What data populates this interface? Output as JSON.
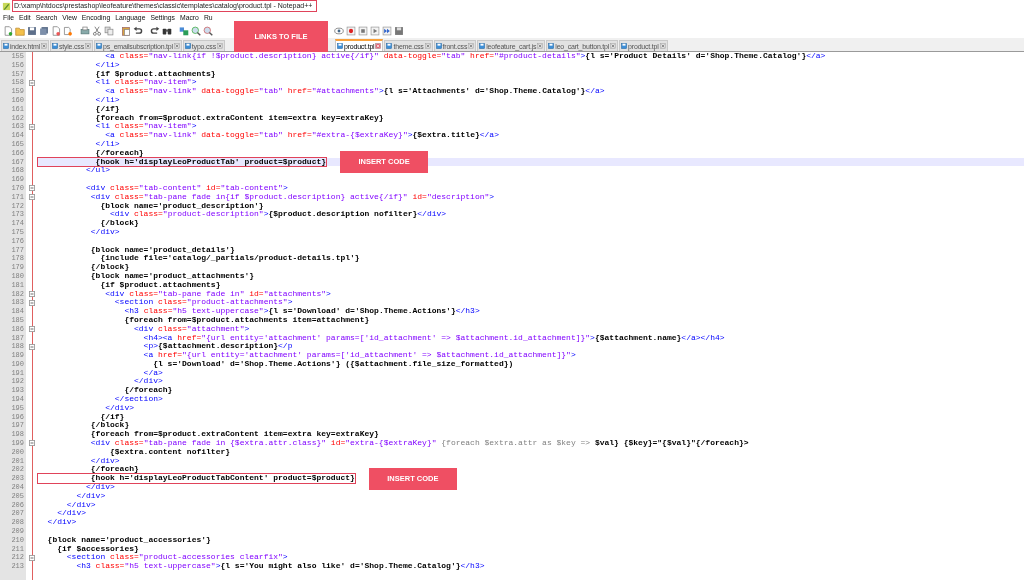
{
  "window": {
    "title": "D:\\xamp\\htdocs\\prestashop\\leofeature\\themes\\classic\\templates\\catalog\\product.tpl - Notepad++",
    "title_highlighted": true
  },
  "menu": [
    "File",
    "Edit",
    "Search",
    "View",
    "Encoding",
    "Language",
    "Settings",
    "Macro",
    "Ru"
  ],
  "links_callout": "LINKS TO FILE",
  "tabs": [
    {
      "label": "index.html",
      "selected": false
    },
    {
      "label": "style.css",
      "selected": false
    },
    {
      "label": "ps_emailsubscription.tpl",
      "selected": false
    },
    {
      "label": "typo.css",
      "selected": false
    },
    {
      "label": "product.tpl",
      "selected": true
    },
    {
      "label": "theme.css",
      "selected": false
    },
    {
      "label": "front.css",
      "selected": false
    },
    {
      "label": "leofeature_cart.js",
      "selected": false
    },
    {
      "label": "leo_cart_button.tpl",
      "selected": false
    },
    {
      "label": "product.tpl",
      "selected": false
    }
  ],
  "lines": [
    {
      "number": "155",
      "current": false,
      "fold": false,
      "tokens": [
        {
          "kind": "tag",
          "text": "              <a"
        },
        {
          "kind": "attr",
          "text": " class="
        },
        {
          "kind": "value",
          "text": "\"nav-link{if !$product.description} active{/if}\""
        },
        {
          "kind": "attr",
          "text": " data-toggle="
        },
        {
          "kind": "value",
          "text": "\"tab\""
        },
        {
          "kind": "attr",
          "text": " href="
        },
        {
          "kind": "value",
          "text": "\"#product-details\""
        },
        {
          "kind": "tag",
          "text": ">"
        },
        {
          "kind": "code",
          "text": "{l s='Product Details' d='Shop.Theme.Catalog'}"
        },
        {
          "kind": "tag",
          "text": "</a>"
        }
      ]
    },
    {
      "number": "156",
      "current": false,
      "fold": false,
      "tokens": [
        {
          "kind": "tag",
          "text": "            </li>"
        }
      ]
    },
    {
      "number": "157",
      "current": false,
      "fold": false,
      "tokens": [
        {
          "kind": "code",
          "text": "            {if $product.attachments}"
        }
      ]
    },
    {
      "number": "158",
      "current": false,
      "fold": true,
      "tokens": [
        {
          "kind": "tag",
          "text": "            <li"
        },
        {
          "kind": "attr",
          "text": " class="
        },
        {
          "kind": "value",
          "text": "\"nav-item\""
        },
        {
          "kind": "tag",
          "text": ">"
        }
      ]
    },
    {
      "number": "159",
      "current": false,
      "fold": false,
      "tokens": [
        {
          "kind": "tag",
          "text": "              <a"
        },
        {
          "kind": "attr",
          "text": " class="
        },
        {
          "kind": "value",
          "text": "\"nav-link\""
        },
        {
          "kind": "attr",
          "text": " data-toggle="
        },
        {
          "kind": "value",
          "text": "\"tab\""
        },
        {
          "kind": "attr",
          "text": " href="
        },
        {
          "kind": "value",
          "text": "\"#attachments\""
        },
        {
          "kind": "tag",
          "text": ">"
        },
        {
          "kind": "code",
          "text": "{l s='Attachments' d='Shop.Theme.Catalog'}"
        },
        {
          "kind": "tag",
          "text": "</a>"
        }
      ]
    },
    {
      "number": "160",
      "current": false,
      "fold": false,
      "tokens": [
        {
          "kind": "tag",
          "text": "            </li>"
        }
      ]
    },
    {
      "number": "161",
      "current": false,
      "fold": false,
      "tokens": [
        {
          "kind": "code",
          "text": "            {/if}"
        }
      ]
    },
    {
      "number": "162",
      "current": false,
      "fold": false,
      "tokens": [
        {
          "kind": "code",
          "text": "            {foreach from=$product.extraContent item=extra key=extraKey}"
        }
      ]
    },
    {
      "number": "163",
      "current": false,
      "fold": true,
      "tokens": [
        {
          "kind": "tag",
          "text": "            <li"
        },
        {
          "kind": "attr",
          "text": " class="
        },
        {
          "kind": "value",
          "text": "\"nav-item\""
        },
        {
          "kind": "tag",
          "text": ">"
        }
      ]
    },
    {
      "number": "164",
      "current": false,
      "fold": false,
      "tokens": [
        {
          "kind": "tag",
          "text": "              <a"
        },
        {
          "kind": "attr",
          "text": " class="
        },
        {
          "kind": "value",
          "text": "\"nav-link\""
        },
        {
          "kind": "attr",
          "text": " data-toggle="
        },
        {
          "kind": "value",
          "text": "\"tab\""
        },
        {
          "kind": "attr",
          "text": " href="
        },
        {
          "kind": "value",
          "text": "\"#extra-{$extraKey}\""
        },
        {
          "kind": "tag",
          "text": ">"
        },
        {
          "kind": "code",
          "text": "{$extra.title}"
        },
        {
          "kind": "tag",
          "text": "</a>"
        }
      ]
    },
    {
      "number": "165",
      "current": false,
      "fold": false,
      "tokens": [
        {
          "kind": "tag",
          "text": "            </li>"
        }
      ]
    },
    {
      "number": "166",
      "current": false,
      "fold": false,
      "tokens": [
        {
          "kind": "code",
          "text": "            {/foreach}"
        }
      ]
    },
    {
      "number": "167",
      "current": true,
      "fold": false,
      "callout": "INSERT CODE",
      "tokens": [
        {
          "kind": "code",
          "text": "            {hook h='displayLeoProductTab' product=$product}"
        }
      ]
    },
    {
      "number": "168",
      "current": false,
      "fold": false,
      "tokens": [
        {
          "kind": "tag",
          "text": "          </ul>"
        }
      ]
    },
    {
      "number": "169",
      "current": false,
      "fold": false
    },
    {
      "number": "170",
      "current": false,
      "fold": true,
      "tokens": [
        {
          "kind": "tag",
          "text": "          <div"
        },
        {
          "kind": "attr",
          "text": " class="
        },
        {
          "kind": "value",
          "text": "\"tab-content\""
        },
        {
          "kind": "attr",
          "text": " id="
        },
        {
          "kind": "value",
          "text": "\"tab-content\""
        },
        {
          "kind": "tag",
          "text": ">"
        }
      ]
    },
    {
      "number": "171",
      "current": false,
      "fold": true,
      "tokens": [
        {
          "kind": "tag",
          "text": "           <div"
        },
        {
          "kind": "attr",
          "text": " class="
        },
        {
          "kind": "value",
          "text": "\"tab-pane fade in{if $product.description} active{/if}\""
        },
        {
          "kind": "attr",
          "text": " id="
        },
        {
          "kind": "value",
          "text": "\"description\""
        },
        {
          "kind": "tag",
          "text": ">"
        }
      ]
    },
    {
      "number": "172",
      "current": false,
      "fold": false,
      "tokens": [
        {
          "kind": "code",
          "text": "             {block name='product_description'}"
        }
      ]
    },
    {
      "number": "173",
      "current": false,
      "fold": false,
      "tokens": [
        {
          "kind": "tag",
          "text": "               <div"
        },
        {
          "kind": "attr",
          "text": " class="
        },
        {
          "kind": "value",
          "text": "\"product-description\""
        },
        {
          "kind": "tag",
          "text": ">"
        },
        {
          "kind": "code",
          "text": "{$product.description nofilter}"
        },
        {
          "kind": "tag",
          "text": "</div>"
        }
      ]
    },
    {
      "number": "174",
      "current": false,
      "fold": false,
      "tokens": [
        {
          "kind": "code",
          "text": "             {/block}"
        }
      ]
    },
    {
      "number": "175",
      "current": false,
      "fold": false,
      "tokens": [
        {
          "kind": "tag",
          "text": "           </div>"
        }
      ]
    },
    {
      "number": "176",
      "current": false,
      "fold": false
    },
    {
      "number": "177",
      "current": false,
      "fold": false,
      "tokens": [
        {
          "kind": "code",
          "text": "           {block name='product_details'}"
        }
      ]
    },
    {
      "number": "178",
      "current": false,
      "fold": false,
      "tokens": [
        {
          "kind": "code",
          "text": "             {include file='catalog/_partials/product-details.tpl'}"
        }
      ]
    },
    {
      "number": "179",
      "current": false,
      "fold": false,
      "tokens": [
        {
          "kind": "code",
          "text": "           {/block}"
        }
      ]
    },
    {
      "number": "180",
      "current": false,
      "fold": false,
      "tokens": [
        {
          "kind": "code",
          "text": "           {block name='product_attachments'}"
        }
      ]
    },
    {
      "number": "181",
      "current": false,
      "fold": false,
      "tokens": [
        {
          "kind": "code",
          "text": "             {if $product.attachments}"
        }
      ]
    },
    {
      "number": "182",
      "current": false,
      "fold": true,
      "tokens": [
        {
          "kind": "tag",
          "text": "              <div"
        },
        {
          "kind": "attr",
          "text": " class="
        },
        {
          "kind": "value",
          "text": "\"tab-pane fade in\""
        },
        {
          "kind": "attr",
          "text": " id="
        },
        {
          "kind": "value",
          "text": "\"attachments\""
        },
        {
          "kind": "tag",
          "text": ">"
        }
      ]
    },
    {
      "number": "183",
      "current": false,
      "fold": true,
      "tokens": [
        {
          "kind": "tag",
          "text": "                <section"
        },
        {
          "kind": "attr",
          "text": " class="
        },
        {
          "kind": "value",
          "text": "\"product-attachments\""
        },
        {
          "kind": "tag",
          "text": ">"
        }
      ]
    },
    {
      "number": "184",
      "current": false,
      "fold": false,
      "tokens": [
        {
          "kind": "tag",
          "text": "                  <h3"
        },
        {
          "kind": "attr",
          "text": " class="
        },
        {
          "kind": "value",
          "text": "\"h5 text-uppercase\""
        },
        {
          "kind": "tag",
          "text": ">"
        },
        {
          "kind": "code",
          "text": "{l s='Download' d='Shop.Theme.Actions'}"
        },
        {
          "kind": "tag",
          "text": "</h3>"
        }
      ]
    },
    {
      "number": "185",
      "current": false,
      "fold": false,
      "tokens": [
        {
          "kind": "code",
          "text": "                  {foreach from=$product.attachments item=attachment}"
        }
      ]
    },
    {
      "number": "186",
      "current": false,
      "fold": true,
      "tokens": [
        {
          "kind": "tag",
          "text": "                    <div"
        },
        {
          "kind": "attr",
          "text": " class="
        },
        {
          "kind": "value",
          "text": "\"attachment\""
        },
        {
          "kind": "tag",
          "text": ">"
        }
      ]
    },
    {
      "number": "187",
      "current": false,
      "fold": false,
      "tokens": [
        {
          "kind": "tag",
          "text": "                      <h4><a"
        },
        {
          "kind": "attr",
          "text": " href="
        },
        {
          "kind": "value",
          "text": "\"{url entity='attachment' params=['id_attachment' => $attachment.id_attachment]}\""
        },
        {
          "kind": "tag",
          "text": ">"
        },
        {
          "kind": "code",
          "text": "{$attachment.name}"
        },
        {
          "kind": "tag",
          "text": "</a></h4>"
        }
      ]
    },
    {
      "number": "188",
      "current": false,
      "fold": true,
      "tokens": [
        {
          "kind": "tag",
          "text": "                      <p>"
        },
        {
          "kind": "code",
          "text": "{$attachment.description}"
        },
        {
          "kind": "tag",
          "text": "</p"
        }
      ]
    },
    {
      "number": "189",
      "current": false,
      "fold": false,
      "tokens": [
        {
          "kind": "tag",
          "text": "                      <a"
        },
        {
          "kind": "attr",
          "text": " href="
        },
        {
          "kind": "value",
          "text": "\"{url entity='attachment' params=['id_attachment' => $attachment.id_attachment]}\""
        },
        {
          "kind": "tag",
          "text": ">"
        }
      ]
    },
    {
      "number": "190",
      "current": false,
      "fold": false,
      "tokens": [
        {
          "kind": "code",
          "text": "                        {l s='Download' d='Shop.Theme.Actions'} ({$attachment.file_size_formatted})"
        }
      ]
    },
    {
      "number": "191",
      "current": false,
      "fold": false,
      "tokens": [
        {
          "kind": "tag",
          "text": "                      </a>"
        }
      ]
    },
    {
      "number": "192",
      "current": false,
      "fold": false,
      "tokens": [
        {
          "kind": "tag",
          "text": "                    </div>"
        }
      ]
    },
    {
      "number": "193",
      "current": false,
      "fold": false,
      "tokens": [
        {
          "kind": "code",
          "text": "                  {/foreach}"
        }
      ]
    },
    {
      "number": "194",
      "current": false,
      "fold": false,
      "tokens": [
        {
          "kind": "tag",
          "text": "                </section>"
        }
      ]
    },
    {
      "number": "195",
      "current": false,
      "fold": false,
      "tokens": [
        {
          "kind": "tag",
          "text": "              </div>"
        }
      ]
    },
    {
      "number": "196",
      "current": false,
      "fold": false,
      "tokens": [
        {
          "kind": "code",
          "text": "             {/if}"
        }
      ]
    },
    {
      "number": "197",
      "current": false,
      "fold": false,
      "tokens": [
        {
          "kind": "code",
          "text": "           {/block}"
        }
      ]
    },
    {
      "number": "198",
      "current": false,
      "fold": false,
      "tokens": [
        {
          "kind": "code",
          "text": "           {foreach from=$product.extraContent item=extra key=extraKey}"
        }
      ]
    },
    {
      "number": "199",
      "current": false,
      "fold": true,
      "tokens": [
        {
          "kind": "tag",
          "text": "           <div"
        },
        {
          "kind": "attr",
          "text": " class="
        },
        {
          "kind": "value",
          "text": "\"tab-pane fade in {$extra.attr.class}\""
        },
        {
          "kind": "attr",
          "text": " id="
        },
        {
          "kind": "value",
          "text": "\"extra-{$extraKey}\""
        },
        {
          "kind": "muted",
          "text": " {foreach $extra.attr as $key =>"
        },
        {
          "kind": "code",
          "text": " $val} {$key}=\"{$val}\"{/foreach}>"
        }
      ]
    },
    {
      "number": "200",
      "current": false,
      "fold": false,
      "tokens": [
        {
          "kind": "code",
          "text": "               {$extra.content nofilter}"
        }
      ]
    },
    {
      "number": "201",
      "current": false,
      "fold": false,
      "tokens": [
        {
          "kind": "tag",
          "text": "           </div>"
        }
      ]
    },
    {
      "number": "202",
      "current": false,
      "fold": false,
      "tokens": [
        {
          "kind": "code",
          "text": "           {/foreach}"
        }
      ]
    },
    {
      "number": "203",
      "current": false,
      "fold": false,
      "callout": "INSERT CODE",
      "tokens": [
        {
          "kind": "code",
          "text": "           {hook h='displayLeoProductTabContent' product=$product}"
        }
      ]
    },
    {
      "number": "204",
      "current": false,
      "fold": false,
      "tokens": [
        {
          "kind": "tag",
          "text": "          </div>"
        }
      ]
    },
    {
      "number": "205",
      "current": false,
      "fold": false,
      "tokens": [
        {
          "kind": "tag",
          "text": "        </div>"
        }
      ]
    },
    {
      "number": "206",
      "current": false,
      "fold": false,
      "tokens": [
        {
          "kind": "tag",
          "text": "      </div>"
        }
      ]
    },
    {
      "number": "207",
      "current": false,
      "fold": false,
      "tokens": [
        {
          "kind": "tag",
          "text": "    </div>"
        }
      ]
    },
    {
      "number": "208",
      "current": false,
      "fold": false,
      "tokens": [
        {
          "kind": "tag",
          "text": "  </div>"
        }
      ]
    },
    {
      "number": "209",
      "current": false,
      "fold": false
    },
    {
      "number": "210",
      "current": false,
      "fold": false,
      "tokens": [
        {
          "kind": "code",
          "text": "  {block name='product_accessories'}"
        }
      ]
    },
    {
      "number": "211",
      "current": false,
      "fold": false,
      "tokens": [
        {
          "kind": "code",
          "text": "    {if $accessories}"
        }
      ]
    },
    {
      "number": "212",
      "current": false,
      "fold": true,
      "tokens": [
        {
          "kind": "tag",
          "text": "      <section"
        },
        {
          "kind": "attr",
          "text": " class="
        },
        {
          "kind": "value",
          "text": "\"product-accessories clearfix\""
        },
        {
          "kind": "tag",
          "text": ">"
        }
      ]
    },
    {
      "number": "213",
      "current": false,
      "fold": false,
      "tokens": [
        {
          "kind": "tag",
          "text": "        <h3"
        },
        {
          "kind": "attr",
          "text": " class="
        },
        {
          "kind": "value",
          "text": "\"h5 text-uppercase\""
        },
        {
          "kind": "tag",
          "text": ">"
        },
        {
          "kind": "code",
          "text": "{l s='You might also like' d='Shop.Theme.Catalog'}"
        },
        {
          "kind": "tag",
          "text": "</h3>"
        }
      ]
    }
  ]
}
